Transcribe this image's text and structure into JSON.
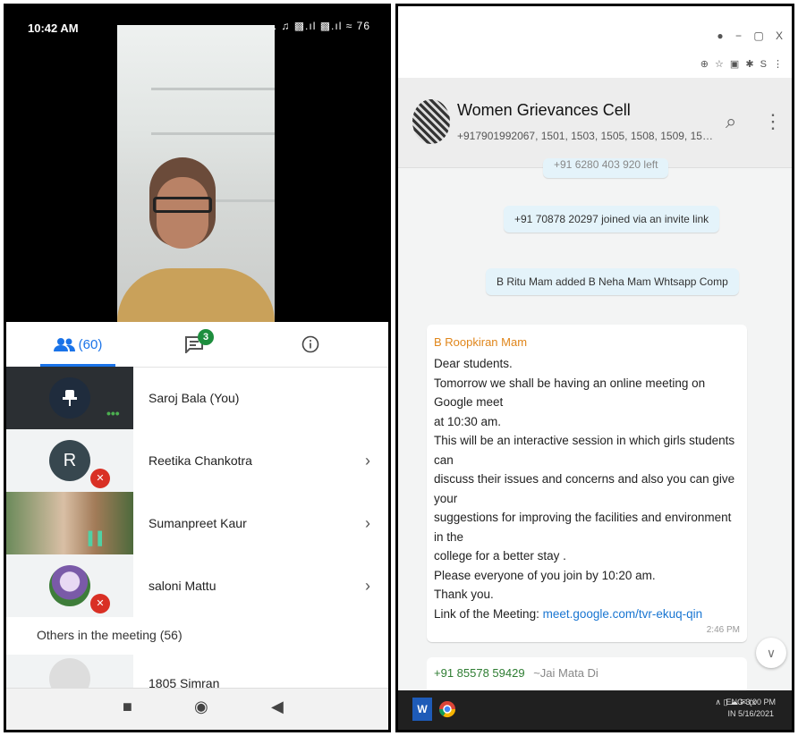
{
  "phone": {
    "status_time": "10:42 AM",
    "status_icons": "... ♫ ▩.ıl ▩.ıl ≈ 76",
    "tabs": {
      "people_count": "(60)",
      "chat_badge": "3"
    },
    "participants": [
      {
        "name": "Saroj Bala (You)"
      },
      {
        "name": "Reetika Chankotra",
        "initial": "R"
      },
      {
        "name": "Sumanpreet Kaur"
      },
      {
        "name": "saloni Mattu"
      }
    ],
    "others_label": "Others in the meeting (56)",
    "partial_participant": "1805 Simran"
  },
  "desktop": {
    "window_controls": "● − ▢ X",
    "extension_icons": "⊕ ☆ ▣ ✱ S ⋮",
    "chat": {
      "title": "Women Grievances Cell",
      "members": "+917901992067, 1501, 1503, 1505, 1508, 1509, 1511, 15..."
    },
    "system_messages": [
      "+91 6280 403 920 left",
      "+91 70878 20297 joined via an invite link",
      "B Ritu Mam added B Neha Mam Whtsapp Comp"
    ],
    "message": {
      "sender": "B Roopkiran Mam",
      "lines": [
        "Dear students.",
        "Tomorrow we shall be having an online meeting on Google meet",
        "at 10:30 am.",
        "This will be an interactive session in which girls students can",
        "discuss their issues and concerns and also you can give your",
        "suggestions for improving the facilities and environment in the",
        "college for a better stay .",
        "Please everyone of you join by 10:20 am.",
        "Thank you."
      ],
      "link_prefix": "Link of the Meeting: ",
      "link": "meet.google.com/tvr-ekuq-qin",
      "time": "2:46 PM"
    },
    "next_message": {
      "sender": "+91 85578 59429",
      "name": "~Jai Mata Di"
    },
    "taskbar": {
      "tray": "∧ ▯ ☁ ✉ (x",
      "lang": "ENG",
      "region": "IN",
      "time": "3:00 PM",
      "date": "5/16/2021"
    }
  }
}
